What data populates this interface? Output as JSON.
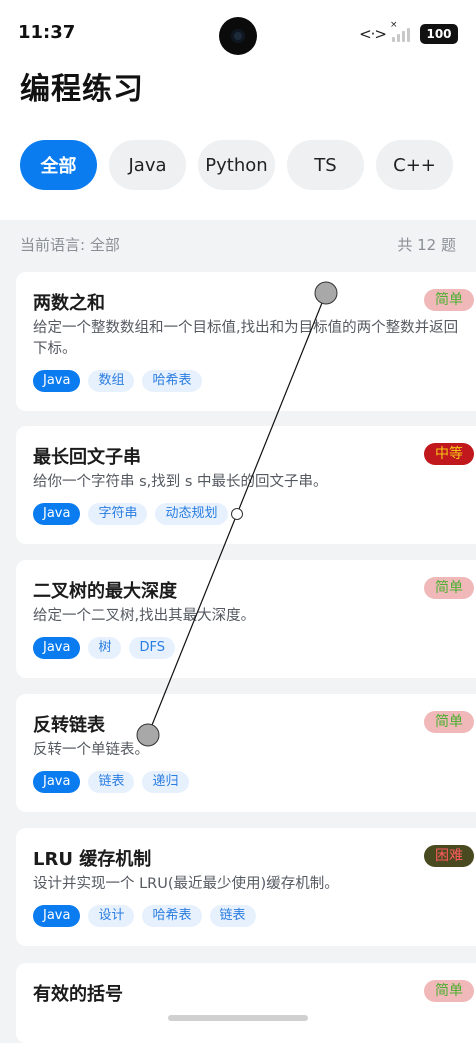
{
  "status_bar": {
    "time": "11:37",
    "battery": "100",
    "code_icon": "<·>",
    "signal_x": "×"
  },
  "header": {
    "title": "编程练习"
  },
  "tabs": [
    {
      "label": "全部",
      "active": true
    },
    {
      "label": "Java",
      "active": false
    },
    {
      "label": "Python",
      "active": false
    },
    {
      "label": "TS",
      "active": false
    },
    {
      "label": "C++",
      "active": false
    }
  ],
  "info": {
    "current_language": "当前语言: 全部",
    "total": "共 12 题"
  },
  "colors": {
    "accent": "#0a7cf0",
    "easy_bg": "#f0b8b8",
    "easy_text": "#4caf32",
    "medium_bg": "#c0181c",
    "medium_text": "#f5c518",
    "hard_bg": "#4a4a20",
    "hard_text": "#ff5a5a"
  },
  "problems": [
    {
      "title": "两数之和",
      "desc": "给定一个整数数组和一个目标值,找出和为目标值的两个整数并返回下标。",
      "difficulty": "简单",
      "level": "easy",
      "tags": [
        "Java",
        "数组",
        "哈希表"
      ]
    },
    {
      "title": "最长回文子串",
      "desc": "给你一个字符串 s,找到 s 中最长的回文子串。",
      "difficulty": "中等",
      "level": "medium",
      "tags": [
        "Java",
        "字符串",
        "动态规划"
      ]
    },
    {
      "title": "二叉树的最大深度",
      "desc": "给定一个二叉树,找出其最大深度。",
      "difficulty": "简单",
      "level": "easy",
      "tags": [
        "Java",
        "树",
        "DFS"
      ]
    },
    {
      "title": "反转链表",
      "desc": "反转一个单链表。",
      "difficulty": "简单",
      "level": "easy",
      "tags": [
        "Java",
        "链表",
        "递归"
      ]
    },
    {
      "title": "LRU 缓存机制",
      "desc": "设计并实现一个 LRU(最近最少使用)缓存机制。",
      "difficulty": "困难",
      "level": "hard",
      "tags": [
        "Java",
        "设计",
        "哈希表",
        "链表"
      ]
    },
    {
      "title": "有效的括号",
      "desc": "",
      "difficulty": "简单",
      "level": "easy",
      "tags": []
    }
  ]
}
